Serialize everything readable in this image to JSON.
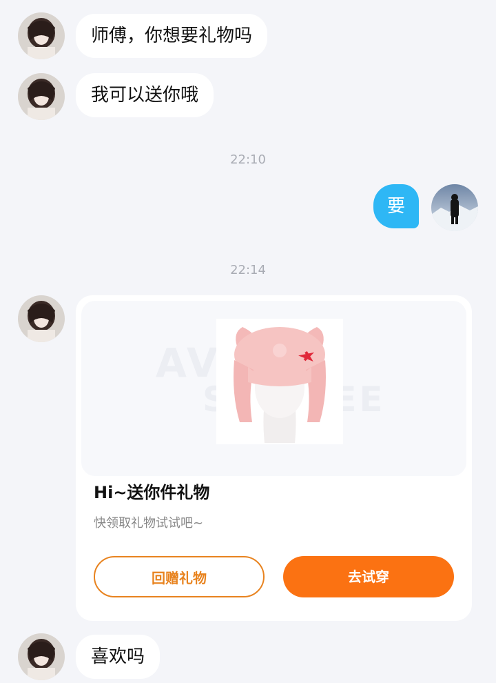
{
  "messages": {
    "m1": "师傅，你想要礼物吗",
    "m2": "我可以送你哦",
    "m3": "要",
    "m4": "喜欢吗"
  },
  "timestamps": {
    "t1": "22:10",
    "t2": "22:14"
  },
  "gift_card": {
    "watermark_top": "AVATAR",
    "watermark_bottom": "SKINFEE",
    "title": "Hi~送你件礼物",
    "subtitle": "快领取礼物试试吧~",
    "return_button": "回赠礼物",
    "try_button": "去试穿"
  },
  "colors": {
    "background": "#f4f5f9",
    "my_bubble": "#2eb7f5",
    "accent_orange": "#fb7212",
    "outline_orange": "#e8831f"
  },
  "icons": {
    "partner_avatar": "girl-portrait-avatar",
    "my_avatar": "mountain-hiker-avatar"
  }
}
